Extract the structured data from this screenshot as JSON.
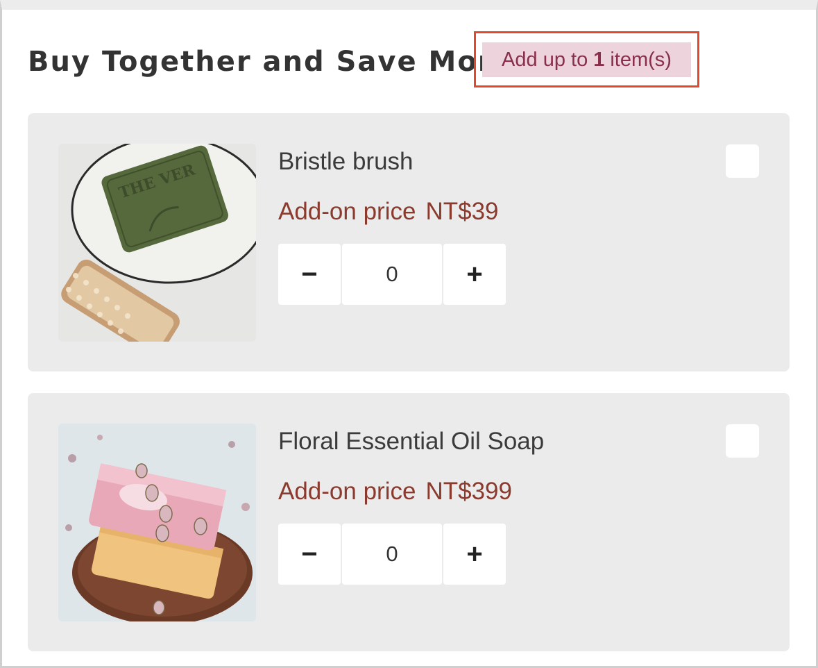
{
  "section": {
    "title": "Buy Together and Save More",
    "limit": {
      "prefix": "Add up to",
      "count": "1",
      "suffix": "item(s)"
    }
  },
  "products": [
    {
      "name": "Bristle brush",
      "price_label": "Add-on price",
      "price": "NT$39",
      "quantity": "0",
      "minus": "−",
      "plus": "+",
      "checked": false,
      "image": "soap-and-bristle-brush-photo"
    },
    {
      "name": "Floral Essential Oil Soap",
      "price_label": "Add-on price",
      "price": "NT$399",
      "quantity": "0",
      "minus": "−",
      "plus": "+",
      "checked": false,
      "image": "floral-soap-bars-photo"
    }
  ],
  "colors": {
    "accent_price": "#8b3a2e",
    "badge_bg": "#ecd3dc",
    "badge_text": "#8a2f4b",
    "highlight_outline": "#e04a2c",
    "card_bg": "#ebebeb"
  }
}
